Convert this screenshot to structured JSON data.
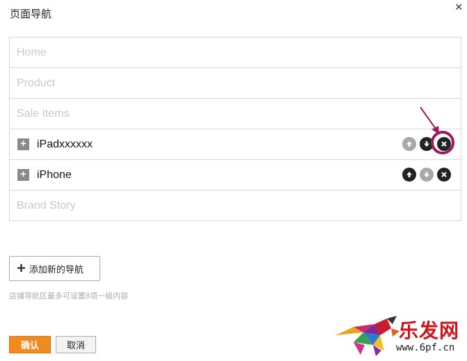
{
  "dialog": {
    "title": "页面导航"
  },
  "nav_items": [
    {
      "placeholder": "Home"
    },
    {
      "placeholder": "Product"
    },
    {
      "placeholder": "Sale Items"
    },
    {
      "label": "iPadxxxxxx"
    },
    {
      "label": "iPhone"
    },
    {
      "placeholder": "Brand Story"
    }
  ],
  "add_button": {
    "label": "添加新的导航"
  },
  "hint": "店铺导航区最多可设置8项一级内容",
  "footer": {
    "confirm_label": "确认",
    "cancel_label": "取消"
  },
  "watermark": {
    "brand": "乐发网",
    "url": "www.6pf.cn"
  },
  "colors": {
    "confirm_bg": "#f18a20",
    "annotation": "#9c1a5a",
    "brand": "#d2141a"
  }
}
